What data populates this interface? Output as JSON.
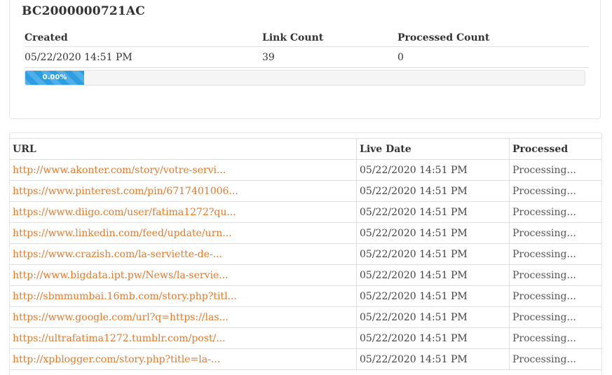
{
  "batch": {
    "id": "BC2000000721AC",
    "headers": {
      "created": "Created",
      "link_count": "Link Count",
      "processed_count": "Processed Count"
    },
    "created": "05/22/2020 14:51 PM",
    "link_count": "39",
    "processed_count": "0",
    "progress": {
      "label": "0.00%",
      "percent": 0,
      "color": "#2a9ee0"
    }
  },
  "links_table": {
    "headers": {
      "url": "URL",
      "live_date": "Live Date",
      "processed": "Processed"
    },
    "rows": [
      {
        "url": "http://www.akonter.com/story/votre-servi...",
        "live_date": "05/22/2020 14:51 PM",
        "processed": "Processing..."
      },
      {
        "url": "https://www.pinterest.com/pin/6717401006...",
        "live_date": "05/22/2020 14:51 PM",
        "processed": "Processing..."
      },
      {
        "url": "https://www.diigo.com/user/fatima1272?qu...",
        "live_date": "05/22/2020 14:51 PM",
        "processed": "Processing..."
      },
      {
        "url": "https://www.linkedin.com/feed/update/urn...",
        "live_date": "05/22/2020 14:51 PM",
        "processed": "Processing..."
      },
      {
        "url": "https://www.crazish.com/la-serviette-de-...",
        "live_date": "05/22/2020 14:51 PM",
        "processed": "Processing..."
      },
      {
        "url": "http://www.bigdata.ipt.pw/News/la-servie...",
        "live_date": "05/22/2020 14:51 PM",
        "processed": "Processing..."
      },
      {
        "url": "http://sbmmumbai.16mb.com/story.php?titl...",
        "live_date": "05/22/2020 14:51 PM",
        "processed": "Processing..."
      },
      {
        "url": "https://www.google.com/url?q=https://las...",
        "live_date": "05/22/2020 14:51 PM",
        "processed": "Processing..."
      },
      {
        "url": "https://ultrafatima1272.tumblr.com/post/...",
        "live_date": "05/22/2020 14:51 PM",
        "processed": "Processing..."
      },
      {
        "url": "http://xpblogger.com/story.php?title=la-...",
        "live_date": "05/22/2020 14:51 PM",
        "processed": "Processing..."
      }
    ],
    "link_color": "#e07a2e"
  }
}
